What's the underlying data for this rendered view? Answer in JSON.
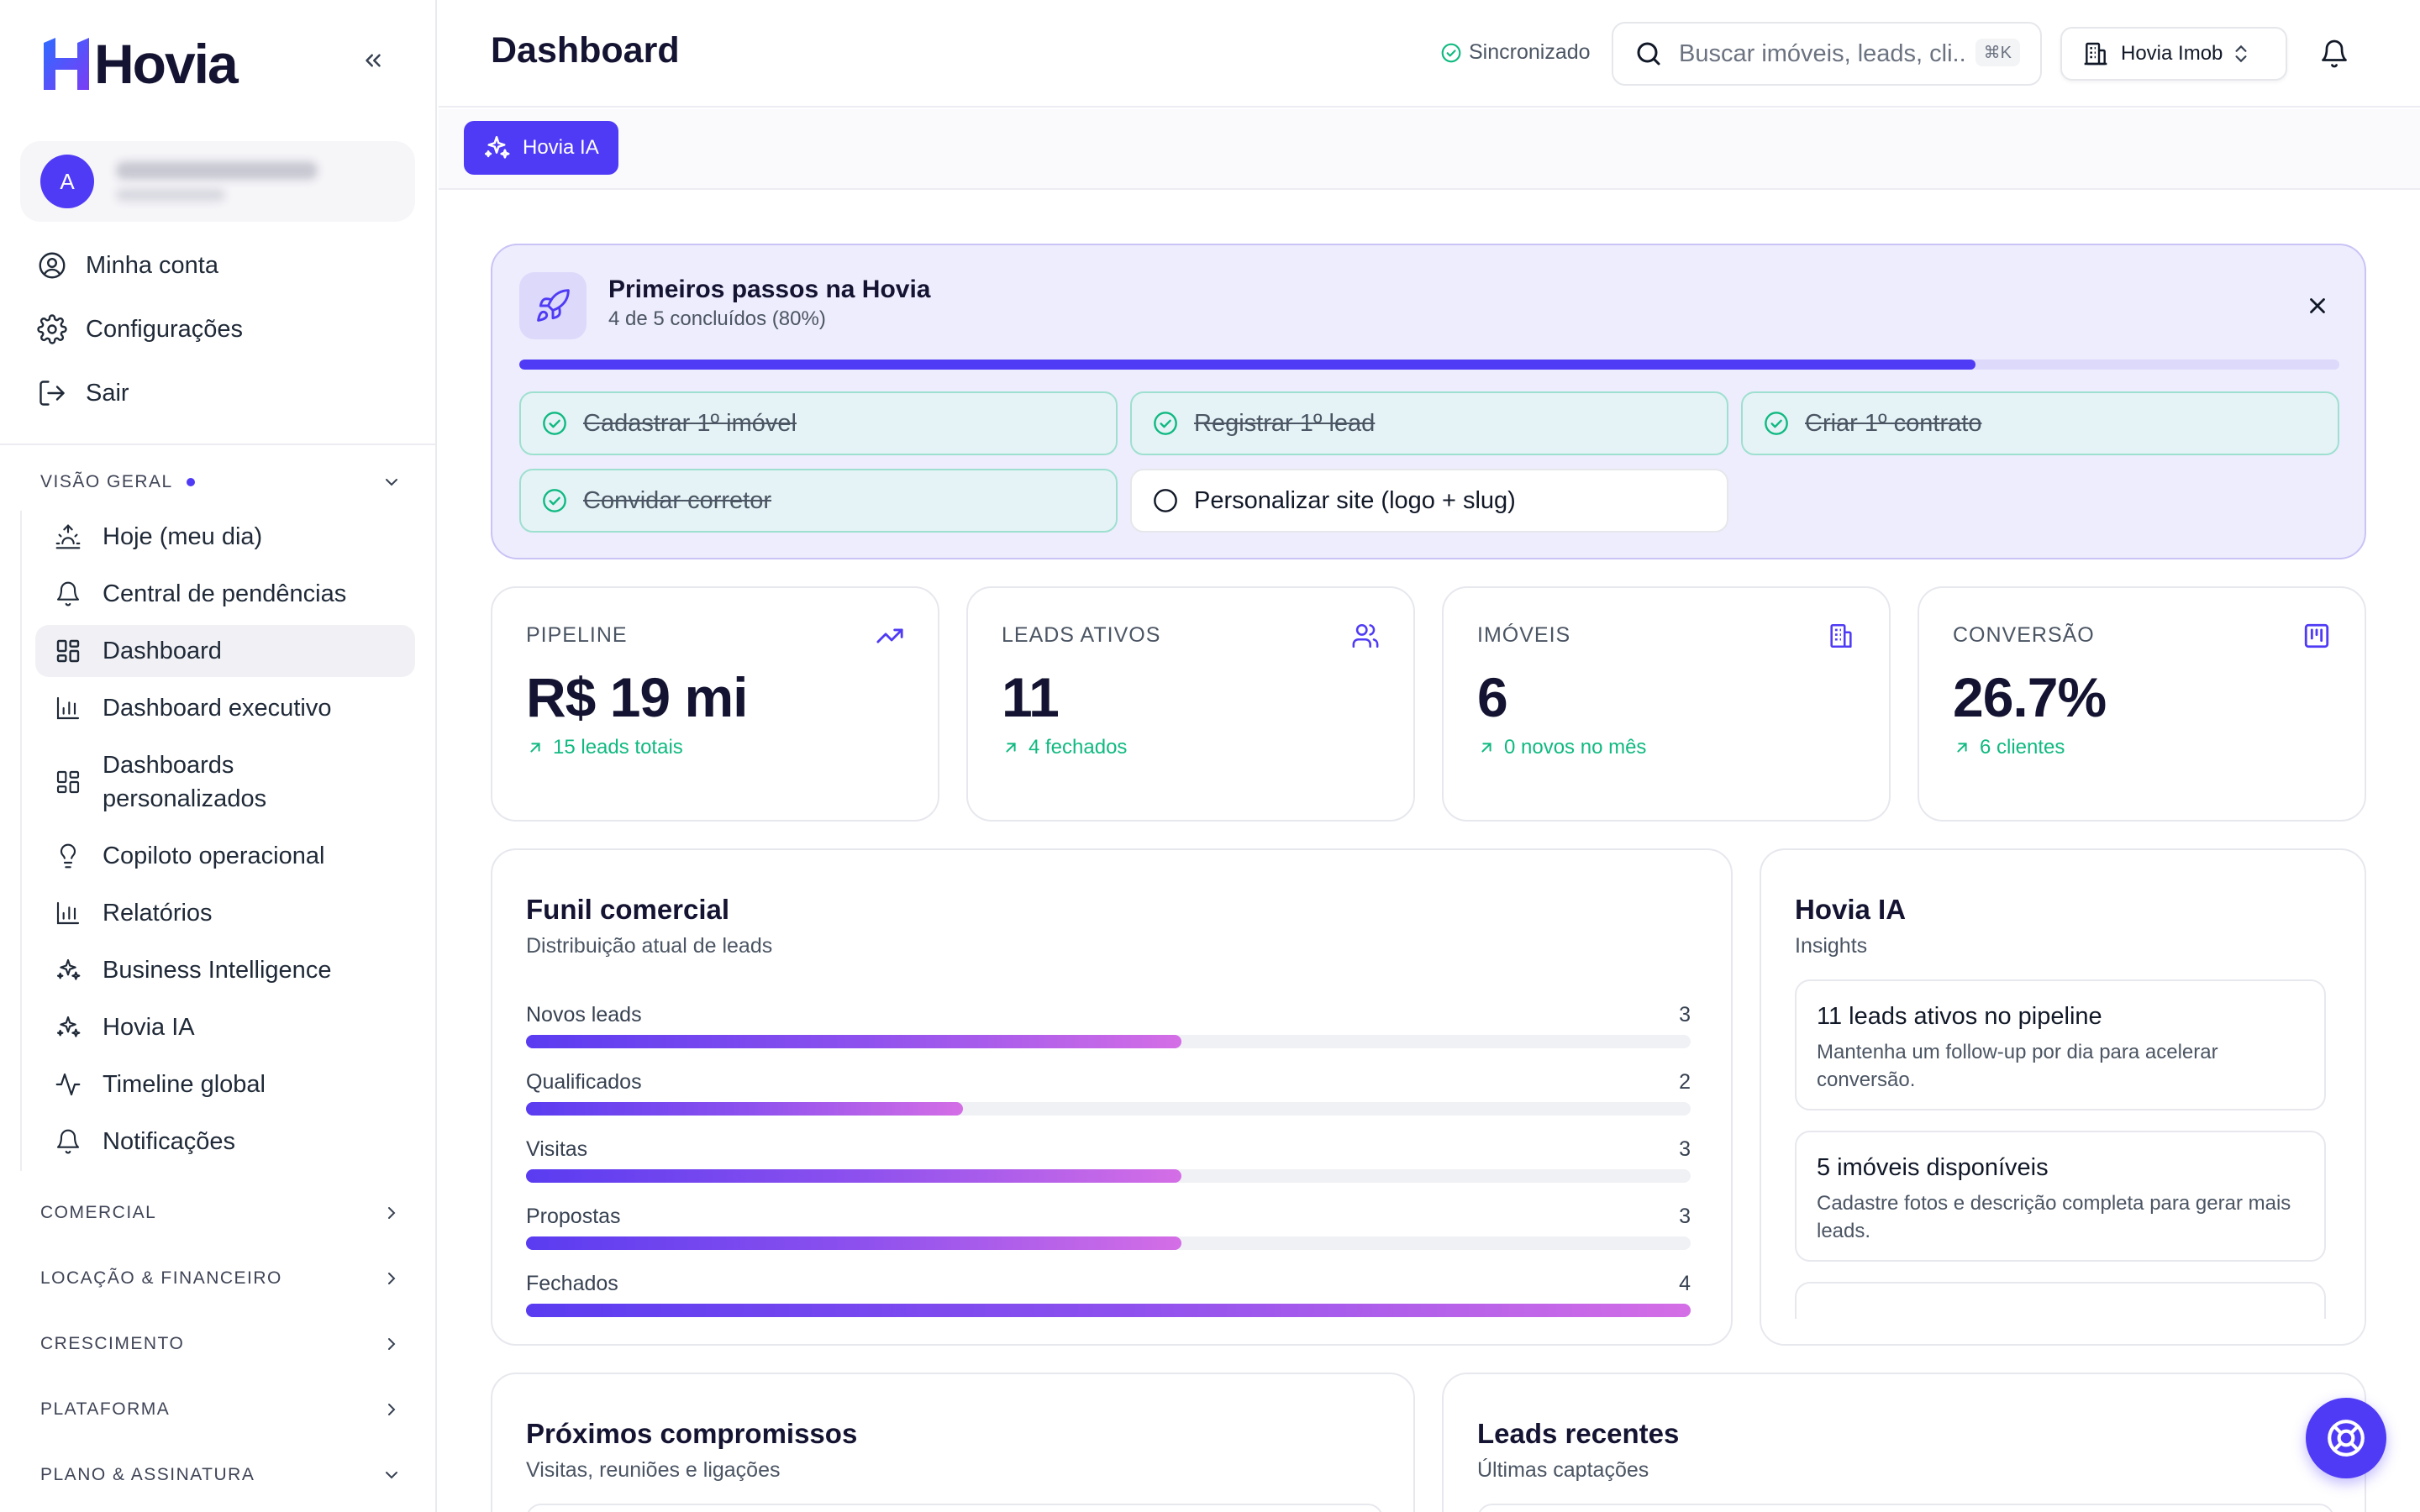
{
  "app": {
    "logo_text": "Hovia",
    "brand_color": "#4f3bf5"
  },
  "sidebar": {
    "profile": {
      "avatar_initial": "A"
    },
    "account_items": [
      {
        "label": "Minha conta",
        "icon": "user-circle-icon"
      },
      {
        "label": "Configurações",
        "icon": "gear-icon"
      },
      {
        "label": "Sair",
        "icon": "logout-icon"
      }
    ],
    "sections": {
      "overview": "VISÃO GERAL",
      "commercial": "COMERCIAL",
      "rental_finance": "LOCAÇÃO & FINANCEIRO",
      "growth": "CRESCIMENTO",
      "platform": "PLATAFORMA",
      "plan": "PLANO & ASSINATURA"
    },
    "nav_items": [
      {
        "label": "Hoje (meu dia)",
        "icon": "sunrise-icon"
      },
      {
        "label": "Central de pendências",
        "icon": "bell-icon"
      },
      {
        "label": "Dashboard",
        "icon": "dashboard-grid-icon",
        "active": true
      },
      {
        "label": "Dashboard executivo",
        "icon": "bar-chart-icon"
      },
      {
        "label": "Dashboards personalizados",
        "icon": "dashboard-grid-icon"
      },
      {
        "label": "Copiloto operacional",
        "icon": "lightbulb-icon"
      },
      {
        "label": "Relatórios",
        "icon": "bar-chart-icon"
      },
      {
        "label": "Business Intelligence",
        "icon": "sparkles-icon"
      },
      {
        "label": "Hovia IA",
        "icon": "sparkles-icon"
      },
      {
        "label": "Timeline global",
        "icon": "activity-icon"
      },
      {
        "label": "Notificações",
        "icon": "bell-icon"
      }
    ]
  },
  "header": {
    "title": "Dashboard",
    "sync_status": "Sincronizado",
    "search_placeholder": "Buscar imóveis, leads, cli...",
    "search_shortcut": "⌘K",
    "org_name": "Hovia Imob"
  },
  "subbar": {
    "ia_button": "Hovia IA"
  },
  "onboarding": {
    "title": "Primeiros passos na Hovia",
    "subtitle": "4 de 5 concluídos (80%)",
    "progress": 0.8,
    "tasks": [
      {
        "label": "Cadastrar 1º imóvel",
        "done": true
      },
      {
        "label": "Registrar 1º lead",
        "done": true
      },
      {
        "label": "Criar 1º contrato",
        "done": true
      },
      {
        "label": "Convidar corretor",
        "done": true
      },
      {
        "label": "Personalizar site (logo + slug)",
        "done": false
      }
    ]
  },
  "kpis": [
    {
      "label": "PIPELINE",
      "value": "R$ 19 mi",
      "note": "15 leads totais",
      "icon": "trending-up-icon"
    },
    {
      "label": "LEADS ATIVOS",
      "value": "11",
      "note": "4 fechados",
      "icon": "users-icon"
    },
    {
      "label": "IMÓVEIS",
      "value": "6",
      "note": "0 novos no mês",
      "icon": "building-icon"
    },
    {
      "label": "CONVERSÃO",
      "value": "26.7%",
      "note": "6 clientes",
      "icon": "kanban-icon"
    }
  ],
  "funnel": {
    "title": "Funil comercial",
    "subtitle": "Distribuição atual de leads",
    "max": 4,
    "stages": [
      {
        "label": "Novos leads",
        "count": "3",
        "value": 3
      },
      {
        "label": "Qualificados",
        "count": "2",
        "value": 2
      },
      {
        "label": "Visitas",
        "count": "3",
        "value": 3
      },
      {
        "label": "Propostas",
        "count": "3",
        "value": 3
      },
      {
        "label": "Fechados",
        "count": "4",
        "value": 4
      }
    ]
  },
  "insights": {
    "title": "Hovia IA",
    "subtitle": "Insights",
    "items": [
      {
        "title": "11 leads ativos no pipeline",
        "body": "Mantenha um follow-up por dia para acelerar conversão."
      },
      {
        "title": "5 imóveis disponíveis",
        "body": "Cadastre fotos e descrição completa para gerar mais leads."
      }
    ]
  },
  "appointments": {
    "title": "Próximos compromissos",
    "subtitle": "Visitas, reuniões e ligações"
  },
  "recent_leads": {
    "title": "Leads recentes",
    "subtitle": "Últimas captações"
  }
}
